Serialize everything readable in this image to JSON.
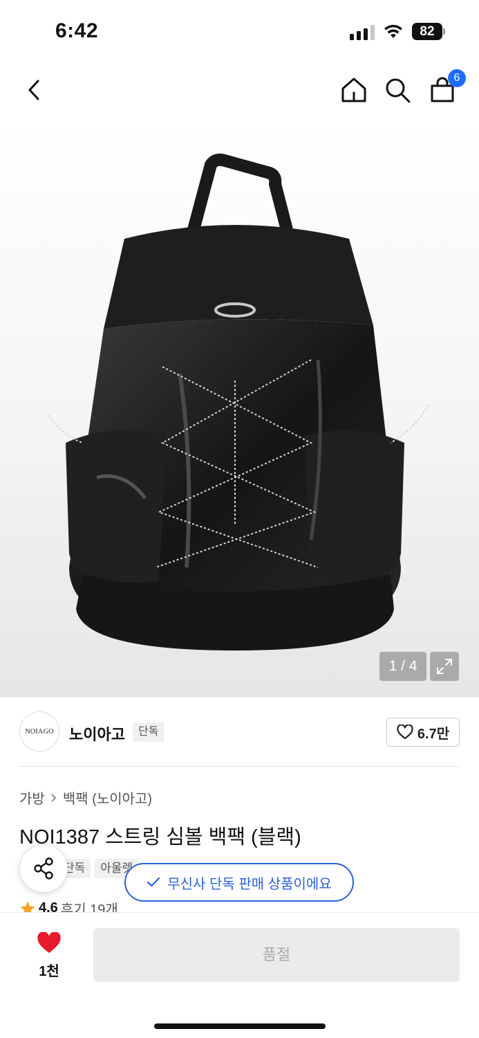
{
  "status_bar": {
    "time": "6:42",
    "battery": "82"
  },
  "nav": {
    "cart_count": "6"
  },
  "gallery": {
    "counter": "1 / 4"
  },
  "brand": {
    "logo_text": "NOIAGO",
    "name": "노이아고",
    "badge": "단독",
    "like_count": "6.7만"
  },
  "breadcrumb": {
    "category": "가방",
    "subcategory": "백팩 (노이아고)"
  },
  "product": {
    "title": "NOI1387 스트링 심볼 백팩 (블랙)",
    "tags": [
      "단독",
      "아울렛"
    ],
    "rating": "4.6",
    "reviews": "후기 19개"
  },
  "exclusive_notice": "무신사 단독 판매 상품이에요",
  "bottom": {
    "wish_count": "1천",
    "action_label": "품절"
  },
  "colors": {
    "accent": "#2b5fd9",
    "badge": "#1e6bff",
    "heart": "#e8192c",
    "star": "#f5a623"
  }
}
